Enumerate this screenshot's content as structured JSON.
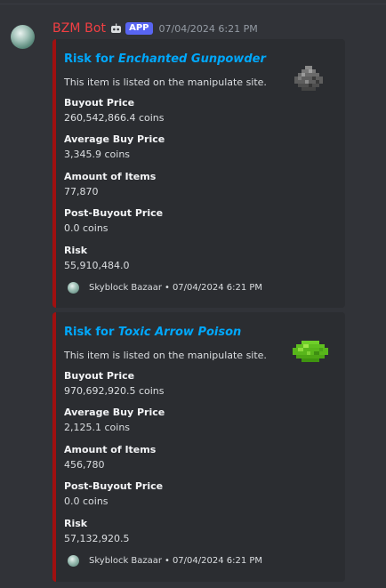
{
  "message": {
    "username": "BZM Bot",
    "app_tag": "APP",
    "timestamp": "07/04/2024 6:21 PM"
  },
  "embeds": [
    {
      "title_prefix": "Risk for ",
      "title_item": "Enchanted Gunpowder",
      "description": "This item is listed on the manipulate site.",
      "thumbnail": "gunpowder-icon",
      "fields": [
        {
          "name": "Buyout Price",
          "value": "260,542,866.4 coins"
        },
        {
          "name": "Average Buy Price",
          "value": "3,345.9 coins"
        },
        {
          "name": "Amount of Items",
          "value": "77,870"
        },
        {
          "name": "Post-Buyout Price",
          "value": "0.0 coins"
        },
        {
          "name": "Risk",
          "value": "55,910,484.0"
        }
      ],
      "footer_source": "Skyblock Bazaar",
      "footer_separator": "•",
      "footer_time": "07/04/2024 6:21 PM"
    },
    {
      "title_prefix": "Risk for ",
      "title_item": "Toxic Arrow Poison",
      "description": "This item is listed on the manipulate site.",
      "thumbnail": "poison-icon",
      "fields": [
        {
          "name": "Buyout Price",
          "value": "970,692,920.5 coins"
        },
        {
          "name": "Average Buy Price",
          "value": "2,125.1 coins"
        },
        {
          "name": "Amount of Items",
          "value": "456,780"
        },
        {
          "name": "Post-Buyout Price",
          "value": "0.0 coins"
        },
        {
          "name": "Risk",
          "value": "57,132,920.5"
        }
      ],
      "footer_source": "Skyblock Bazaar",
      "footer_separator": "•",
      "footer_time": "07/04/2024 6:21 PM"
    }
  ],
  "colors": {
    "background": "#313338",
    "embed_background": "#2b2d31",
    "embed_border": "#a01010",
    "username": "#f23f43",
    "link_title": "#00a8fc",
    "app_tag": "#5865f2"
  }
}
